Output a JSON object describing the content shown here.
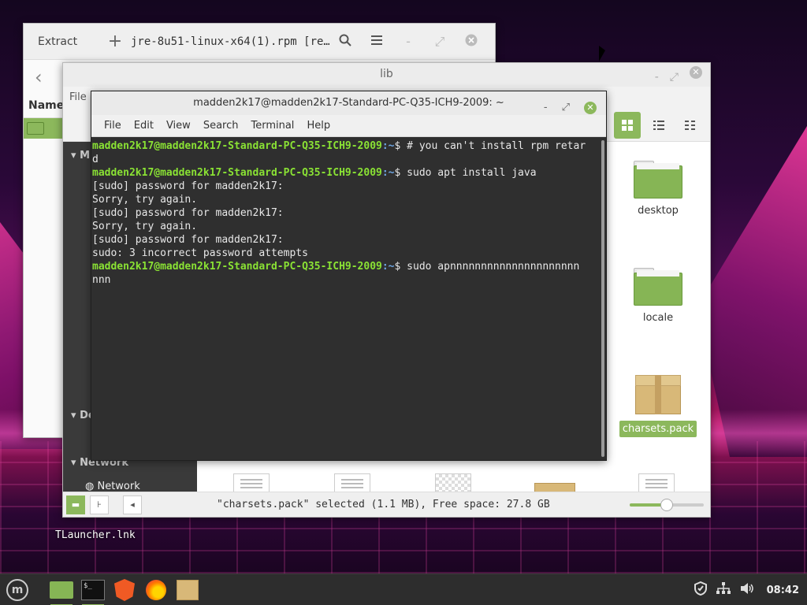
{
  "archive_window": {
    "extract_label": "Extract",
    "plus_label": "+",
    "title": "jre-8u51-linux-x64(1).rpm [re…",
    "column_name": "Name",
    "back_arrow": "‹",
    "icons": {
      "search": "search-icon",
      "menu": "hamburger-icon",
      "minimize": "minimize-icon",
      "maximize": "maximize-icon",
      "close": "close-icon"
    }
  },
  "file_manager": {
    "title": "lib",
    "file_menu_partial": "File",
    "sidebar": {
      "section_my_computer_partial": "M",
      "section_devices_partial": "De",
      "section_network": "Network",
      "network_item": "Network"
    },
    "items": [
      {
        "name": "desktop",
        "type": "folder"
      },
      {
        "name": "locale",
        "type": "folder"
      },
      {
        "name": "charsets.pack",
        "type": "package",
        "selected": true
      }
    ],
    "status_text": "\"charsets.pack\" selected (1.1 MB), Free space: 27.8 GB",
    "zoom_level": 0.5
  },
  "terminal": {
    "title": "madden2k17@madden2k17-Standard-PC-Q35-ICH9-2009: ~",
    "menu": [
      "File",
      "Edit",
      "View",
      "Search",
      "Terminal",
      "Help"
    ],
    "prompt_user": "madden2k17@madden2k17-Standard-PC-Q35-ICH9-2009",
    "prompt_path": ":~",
    "prompt_symbol": "$ ",
    "lines": {
      "l1_cmd": "# you can't install rpm retar",
      "l1_wrap": "d",
      "l2_cmd": "sudo apt install java",
      "l3": "[sudo] password for madden2k17:",
      "l4": "Sorry, try again.",
      "l5": "[sudo] password for madden2k17:",
      "l6": "Sorry, try again.",
      "l7": "[sudo] password for madden2k17:",
      "l8": "sudo: 3 incorrect password attempts",
      "l9_cmd": "sudo apnnnnnnnnnnnnnnnnnnnnn",
      "l9_wrap": "nnn"
    }
  },
  "desktop": {
    "icon_label": "TLauncher.lnk"
  },
  "taskbar": {
    "clock": "08:42",
    "terminal_glyph": "$_",
    "colors": {
      "accent": "#8cb85c",
      "taskbar_bg": "#2d2d2d"
    }
  }
}
